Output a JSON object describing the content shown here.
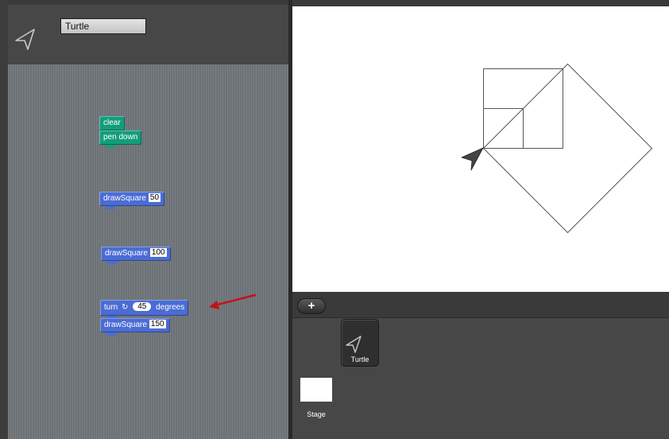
{
  "sprite": {
    "name": "Turtle",
    "icon": "arrow-turtle-icon"
  },
  "scripts": {
    "clear_label": "clear",
    "pen_down_label": "pen down",
    "draw_label": "drawSquare",
    "draw_square_a_value": "50",
    "draw_square_b_value": "100",
    "turn_label": "turn",
    "turn_glyph": "↻",
    "turn_value": "45",
    "degrees_label": "degrees",
    "draw_square_c_value": "150"
  },
  "corral": {
    "add_label": "+",
    "turtle_label": "Turtle",
    "stage_label": "Stage"
  },
  "colors": {
    "pen_block": "#139e7b",
    "motion_block": "#4a6cd4",
    "annotation_arrow": "#c0141b"
  }
}
